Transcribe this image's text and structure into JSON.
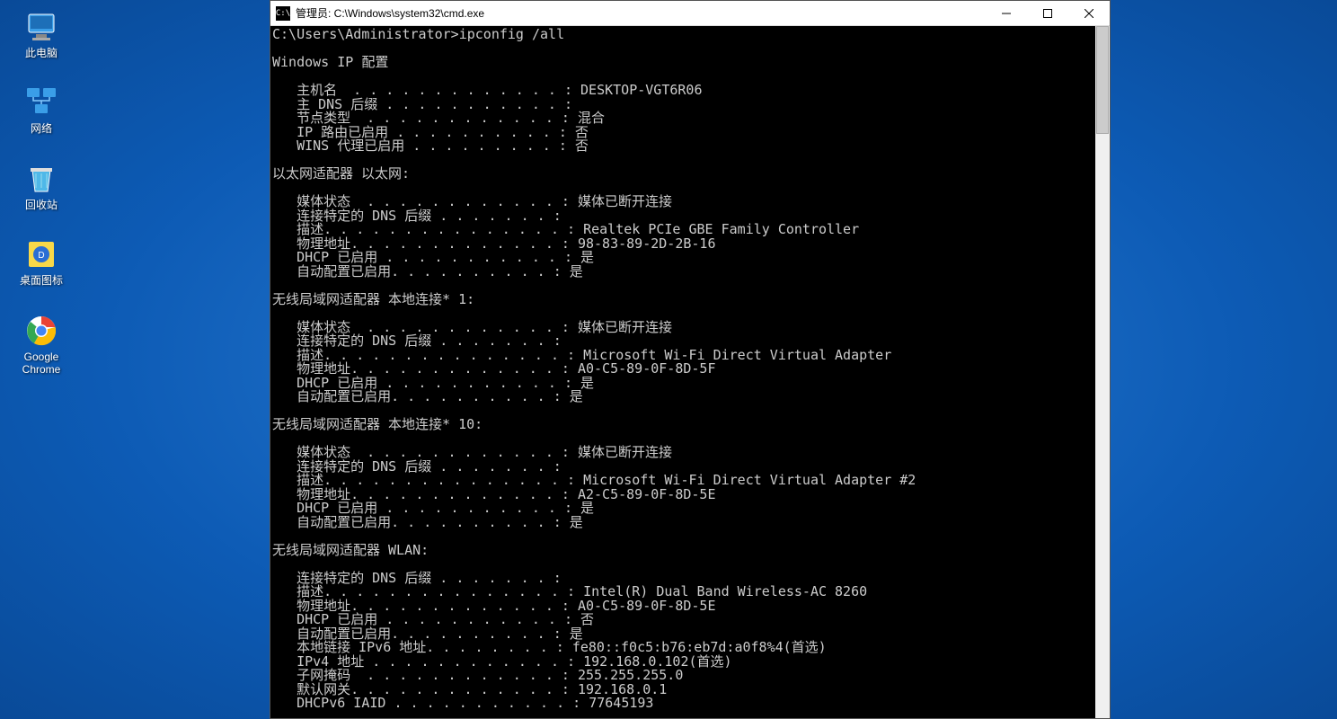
{
  "desktop": {
    "icons": [
      {
        "name": "this-pc-icon",
        "label": "此电脑"
      },
      {
        "name": "network-icon",
        "label": "网络"
      },
      {
        "name": "recycle-bin-icon",
        "label": "回收站"
      },
      {
        "name": "desktop-icons-app-icon",
        "label": "桌面图标"
      },
      {
        "name": "chrome-icon",
        "label": "Google Chrome"
      }
    ]
  },
  "window": {
    "icon_text": "C:\\",
    "title": "管理员: C:\\Windows\\system32\\cmd.exe"
  },
  "terminal": {
    "prompt": "C:\\Users\\Administrator>ipconfig /all",
    "blank": "",
    "header": "Windows IP 配置",
    "host_line": "   主机名  . . . . . . . . . . . . . : DESKTOP-VGT6R06",
    "dns_suffix_line": "   主 DNS 后缀 . . . . . . . . . . . :",
    "node_type_line": "   节点类型  . . . . . . . . . . . . : 混合",
    "ip_route_line": "   IP 路由已启用 . . . . . . . . . . : 否",
    "wins_proxy_line": "   WINS 代理已启用 . . . . . . . . . : 否",
    "eth_header": "以太网适配器 以太网:",
    "eth_media": "   媒体状态  . . . . . . . . . . . . : 媒体已断开连接",
    "eth_dns_suffix": "   连接特定的 DNS 后缀 . . . . . . . :",
    "eth_desc": "   描述. . . . . . . . . . . . . . . : Realtek PCIe GBE Family Controller",
    "eth_phys": "   物理地址. . . . . . . . . . . . . : 98-83-89-2D-2B-16",
    "eth_dhcp": "   DHCP 已启用 . . . . . . . . . . . : 是",
    "eth_autoconf": "   自动配置已启用. . . . . . . . . . : 是",
    "wlan1_header": "无线局域网适配器 本地连接* 1:",
    "wlan1_media": "   媒体状态  . . . . . . . . . . . . : 媒体已断开连接",
    "wlan1_dns_suffix": "   连接特定的 DNS 后缀 . . . . . . . :",
    "wlan1_desc": "   描述. . . . . . . . . . . . . . . : Microsoft Wi-Fi Direct Virtual Adapter",
    "wlan1_phys": "   物理地址. . . . . . . . . . . . . : A0-C5-89-0F-8D-5F",
    "wlan1_dhcp": "   DHCP 已启用 . . . . . . . . . . . : 是",
    "wlan1_autoconf": "   自动配置已启用. . . . . . . . . . : 是",
    "wlan10_header": "无线局域网适配器 本地连接* 10:",
    "wlan10_media": "   媒体状态  . . . . . . . . . . . . : 媒体已断开连接",
    "wlan10_dns_suffix": "   连接特定的 DNS 后缀 . . . . . . . :",
    "wlan10_desc": "   描述. . . . . . . . . . . . . . . : Microsoft Wi-Fi Direct Virtual Adapter #2",
    "wlan10_phys": "   物理地址. . . . . . . . . . . . . : A2-C5-89-0F-8D-5E",
    "wlan10_dhcp": "   DHCP 已启用 . . . . . . . . . . . : 是",
    "wlan10_autoconf": "   自动配置已启用. . . . . . . . . . : 是",
    "wlan_header": "无线局域网适配器 WLAN:",
    "wlan_dns_suffix": "   连接特定的 DNS 后缀 . . . . . . . :",
    "wlan_desc": "   描述. . . . . . . . . . . . . . . : Intel(R) Dual Band Wireless-AC 8260",
    "wlan_phys": "   物理地址. . . . . . . . . . . . . : A0-C5-89-0F-8D-5E",
    "wlan_dhcp": "   DHCP 已启用 . . . . . . . . . . . : 否",
    "wlan_autoconf": "   自动配置已启用. . . . . . . . . . : 是",
    "wlan_ipv6": "   本地链接 IPv6 地址. . . . . . . . : fe80::f0c5:b76:eb7d:a0f8%4(首选)",
    "wlan_ipv4": "   IPv4 地址 . . . . . . . . . . . . : 192.168.0.102(首选)",
    "wlan_mask": "   子网掩码  . . . . . . . . . . . . : 255.255.255.0",
    "wlan_gateway": "   默认网关. . . . . . . . . . . . . : 192.168.0.1",
    "wlan_iaid": "   DHCPv6 IAID . . . . . . . . . . . : 77645193"
  }
}
